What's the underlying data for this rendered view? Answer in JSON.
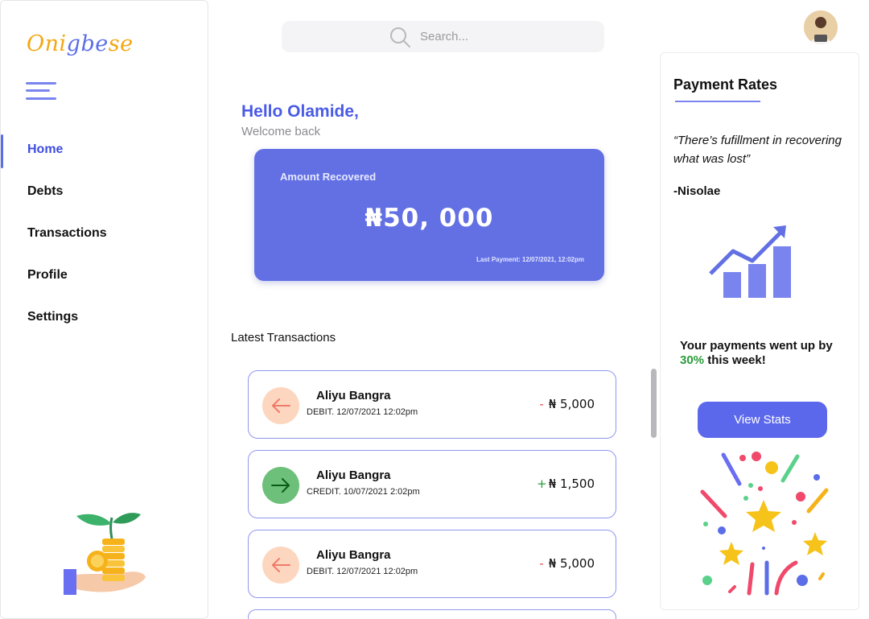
{
  "brand": {
    "part1": "Oni",
    "part2": "gbe",
    "part3": "se"
  },
  "search": {
    "placeholder": "Search..."
  },
  "nav": {
    "items": [
      {
        "label": "Home",
        "active": true
      },
      {
        "label": "Debts"
      },
      {
        "label": "Transactions"
      },
      {
        "label": "Profile"
      },
      {
        "label": "Settings"
      }
    ]
  },
  "greeting": {
    "title": "Hello Olamide,",
    "subtitle": "Welcome back"
  },
  "amount_card": {
    "label": "Amount Recovered",
    "value": "₦50, 000",
    "last_payment": "Last Payment: 12/07/2021, 12:02pm"
  },
  "transactions": {
    "title": "Latest Transactions",
    "items": [
      {
        "name": "Aliyu Bangra",
        "detail": "DEBIT. 12/07/2021  12:02pm",
        "sign": "-",
        "amount": "₦ 5,000",
        "type": "debit"
      },
      {
        "name": "Aliyu Bangra",
        "detail": "CREDIT. 10/07/2021  2:02pm",
        "sign": "+",
        "amount": "₦ 1,500",
        "type": "credit"
      },
      {
        "name": "Aliyu Bangra",
        "detail": "DEBIT. 12/07/2021  12:02pm",
        "sign": "-",
        "amount": "₦ 5,000",
        "type": "debit"
      }
    ]
  },
  "rates": {
    "title": "Payment Rates",
    "quote": "“There’s fufillment in recovering what was lost”",
    "author": "-Nisolae",
    "note_prefix": "Your payments went up by ",
    "note_pct": "30%",
    "note_suffix": " this week!",
    "button": "View Stats"
  },
  "colors": {
    "accent": "#6270e4",
    "primary_text": "#4a5be5",
    "positive": "#2a9b3a",
    "negative": "#e04848"
  },
  "icons": [
    "hamburger-menu-icon",
    "search-icon",
    "arrow-left-icon",
    "arrow-right-icon",
    "growth-chart-icon",
    "confetti-illustration",
    "money-plant-illustration"
  ]
}
